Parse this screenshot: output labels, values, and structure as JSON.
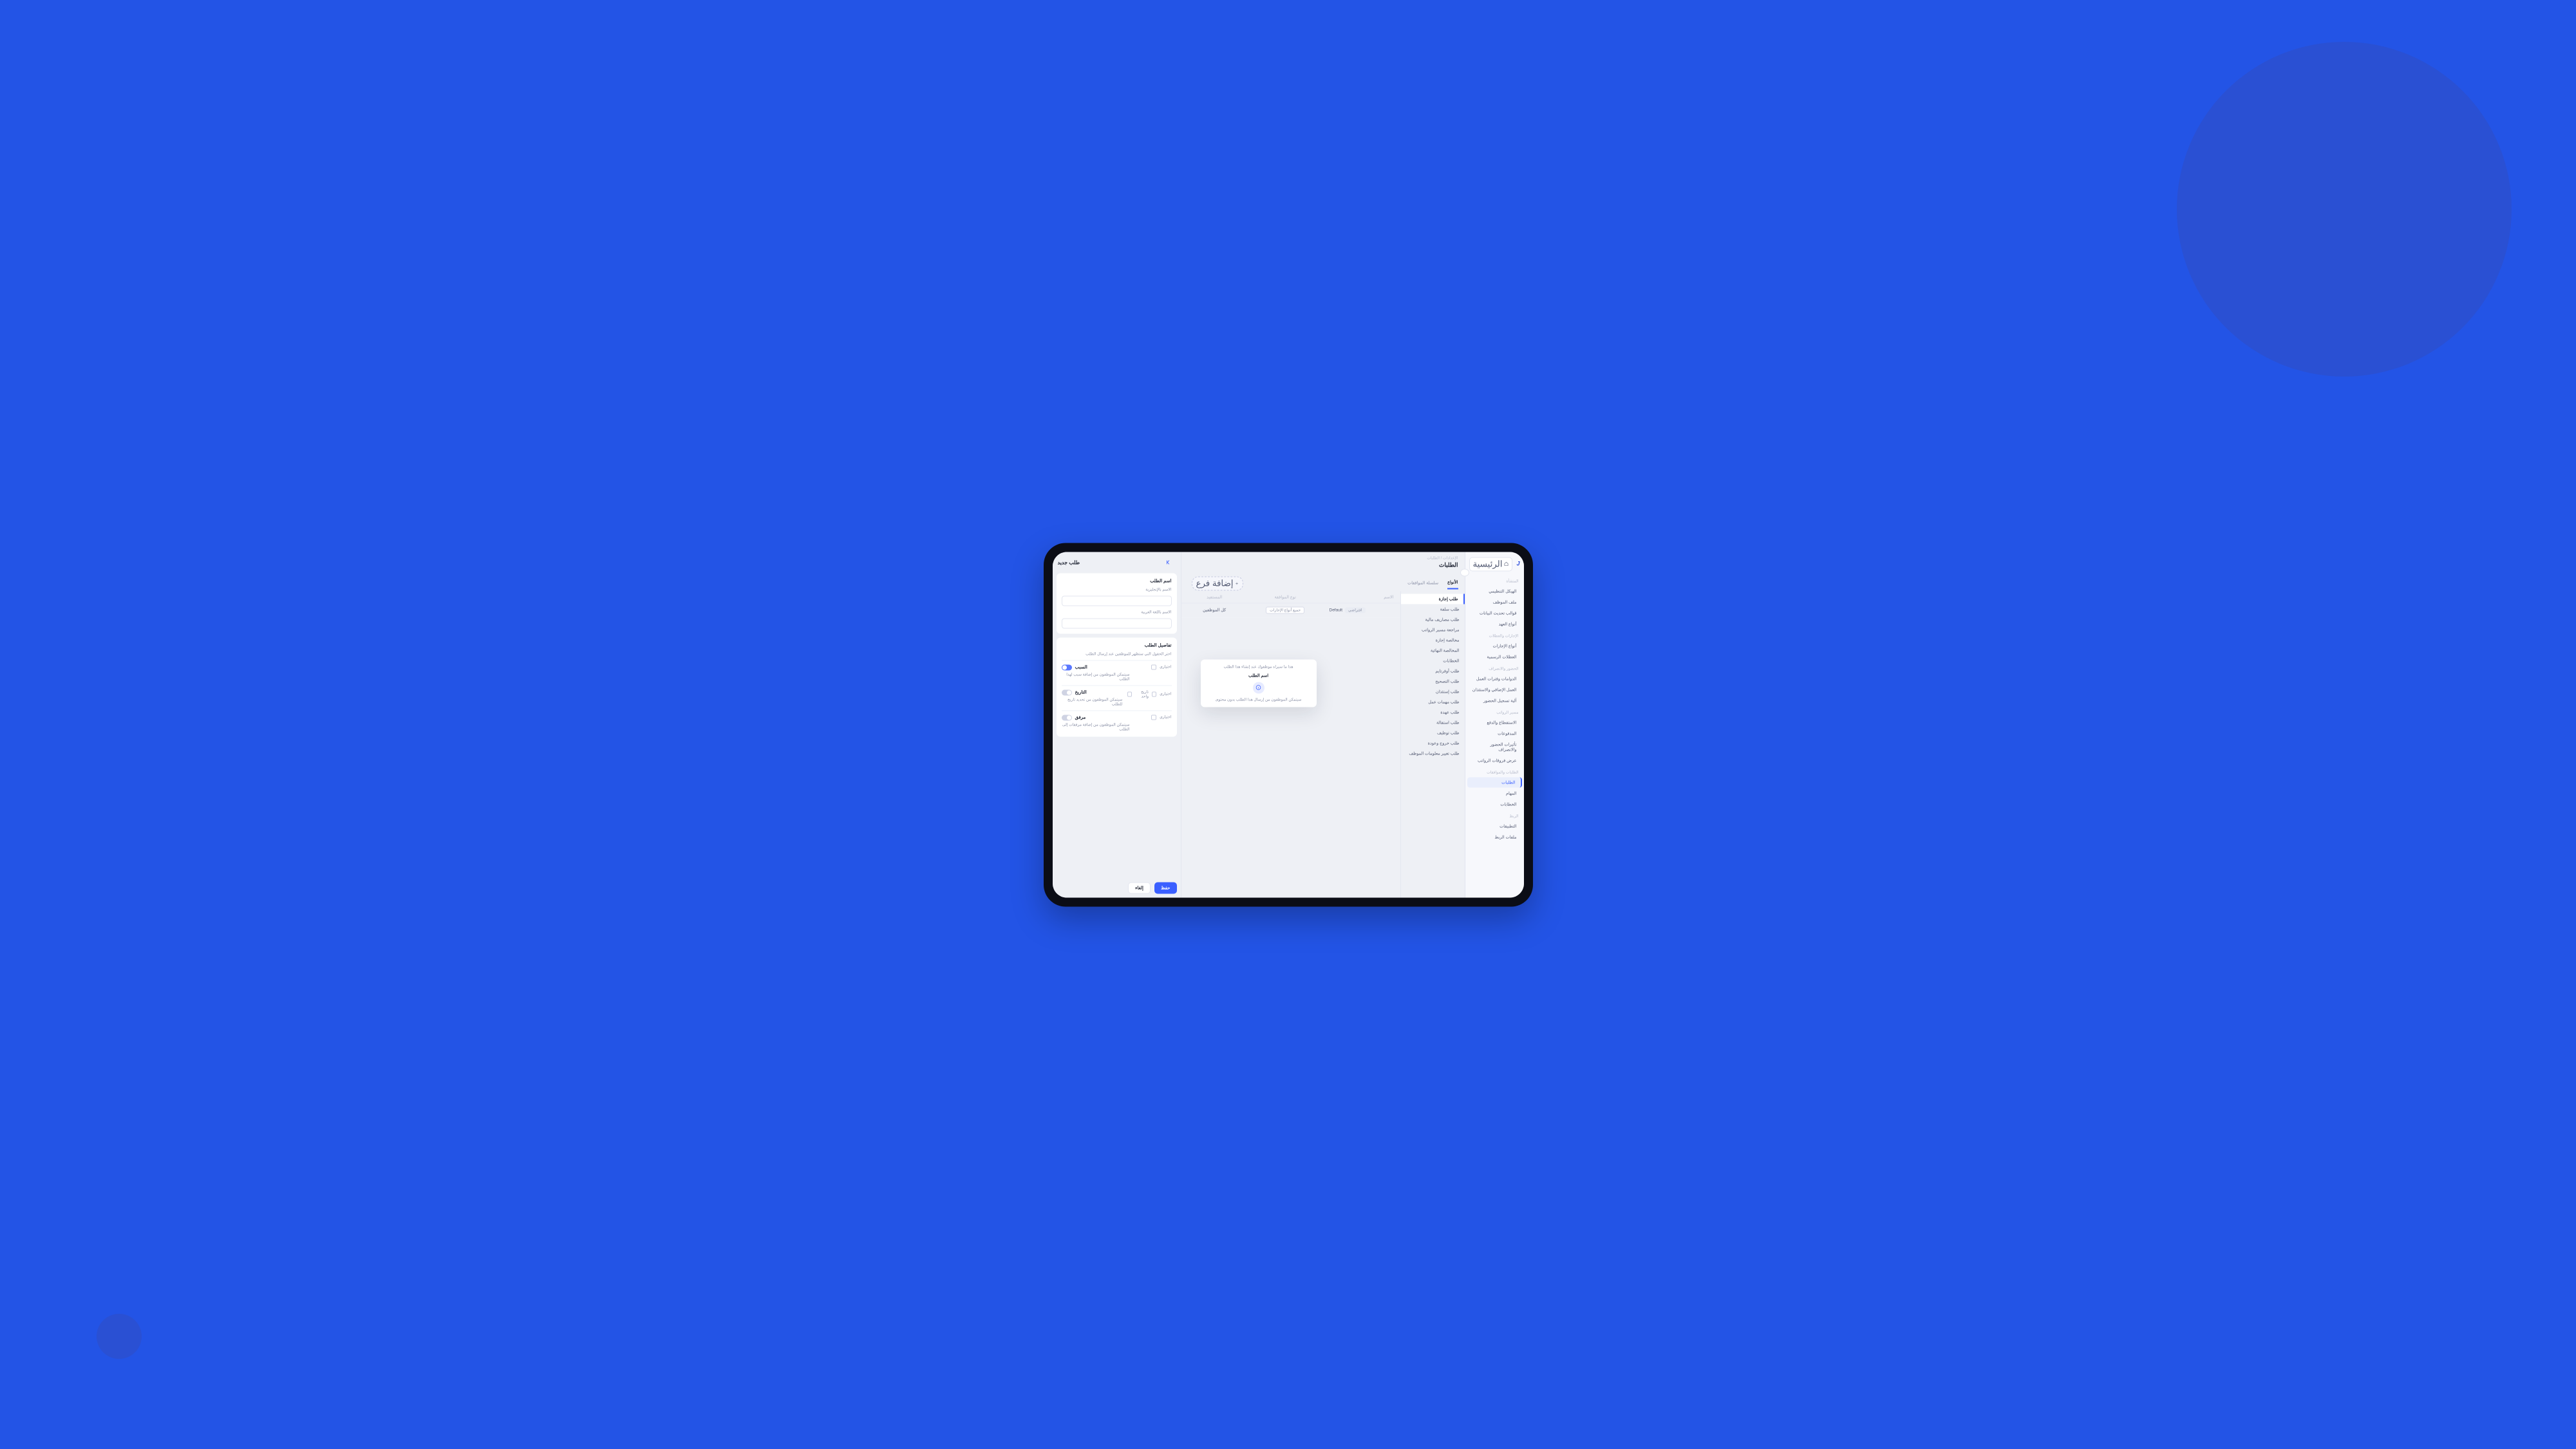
{
  "sidebar": {
    "logo": "J",
    "home_label": "الرئيسية",
    "groups": [
      {
        "title": "المنشأة",
        "items": [
          {
            "label": "الهيكل التنظيمي"
          },
          {
            "label": "ملف الموظف"
          },
          {
            "label": "قوالب تحديث البيانات"
          },
          {
            "label": "أنواع العهد"
          }
        ]
      },
      {
        "title": "الإجازات والعطلات",
        "items": [
          {
            "label": "أنواع الإجازات"
          },
          {
            "label": "العطلات الرسمية"
          }
        ]
      },
      {
        "title": "الحضور والانصراف",
        "items": [
          {
            "label": "الدوامات وفترات العمل"
          },
          {
            "label": "العمل الإضافي والاستئذان"
          },
          {
            "label": "آلية تسجيل الحضور"
          }
        ]
      },
      {
        "title": "مسير الرواتب",
        "items": [
          {
            "label": "الاستقطاع والدفع"
          },
          {
            "label": "المدفوعات"
          },
          {
            "label": "تأثيرات الحضور والانصراف"
          },
          {
            "label": "عرض فروقات الرواتب"
          }
        ]
      },
      {
        "title": "الطلبات والموافقات",
        "items": [
          {
            "label": "الطلبات",
            "active": true
          },
          {
            "label": "المهام"
          },
          {
            "label": "الخطابات"
          }
        ]
      },
      {
        "title": "الربط",
        "items": [
          {
            "label": "التطبيقات"
          },
          {
            "label": "ملفات الربط"
          }
        ]
      }
    ]
  },
  "header": {
    "breadcrumb": "الإعدادات / الطلبات",
    "title": "الطلبات",
    "tabs": {
      "types": "الأنواع",
      "chain": "سلسلة الموافقات"
    },
    "add_branch": "إضافة فرع"
  },
  "types": [
    {
      "label": "طلب إجازة",
      "active": true
    },
    {
      "label": "طلب سلفة"
    },
    {
      "label": "طلب مصاريف مالية"
    },
    {
      "label": "مراجعة مسير الرواتب"
    },
    {
      "label": "مخالصة إجازة"
    },
    {
      "label": "المخالصة النهائية"
    },
    {
      "label": "الخطابات"
    },
    {
      "label": "طلب أوفرتايم"
    },
    {
      "label": "طلب التصحيح"
    },
    {
      "label": "طلب إستئذان"
    },
    {
      "label": "طلب مهمات عمل"
    },
    {
      "label": "طلب عهدة"
    },
    {
      "label": "طلب استقالة"
    },
    {
      "label": "طلب توظيف"
    },
    {
      "label": "طلب خروج وعودة"
    },
    {
      "label": "طلب تغيير معلومات الموظف"
    }
  ],
  "table": {
    "head": {
      "name": "الاسم",
      "approval": "نوع الموافقة",
      "category": "المستفيد"
    },
    "row": {
      "name": "Default",
      "default_chip": "افتراضي",
      "approval_chip": "جميع أنواع الإجازات",
      "category": "كل الموظفين"
    }
  },
  "preview": {
    "subtitle": "هذا ما سيراه موظفوك عند إنشاء هذا الطلب",
    "name": "اسم الطلب",
    "note": "سيتمكن الموظفون من إرسال هذا الطلب بدون محتوى"
  },
  "drawer": {
    "title": "طلب جديد",
    "name_heading": "اسم الطلب",
    "en_label": "الاسم بالإنجليزية",
    "ar_label": "الاسم باللغة العربية",
    "details_heading": "تفاصيل الطلب",
    "details_desc": "اختر الحقول التي ستظهر للموظفين عند إرسال الطلب",
    "fields": {
      "reason": {
        "title": "السبب",
        "desc": "سيتمكن الموظفون من إضافة سبب لهذا الطلب",
        "optional": "اختياري"
      },
      "date": {
        "title": "التاريخ",
        "desc": "سيتمكن الموظفون من تحديد تاريخ للطلب",
        "optional": "اختياري",
        "extra_check": "تاريخ واحد"
      },
      "attach": {
        "title": "مرفق",
        "desc": "سيتمكن الموظفون من إضافة مرفقات إلى الطلب",
        "optional": "اختياري"
      }
    },
    "actions": {
      "save": "حفظ",
      "cancel": "إلغاء"
    }
  }
}
